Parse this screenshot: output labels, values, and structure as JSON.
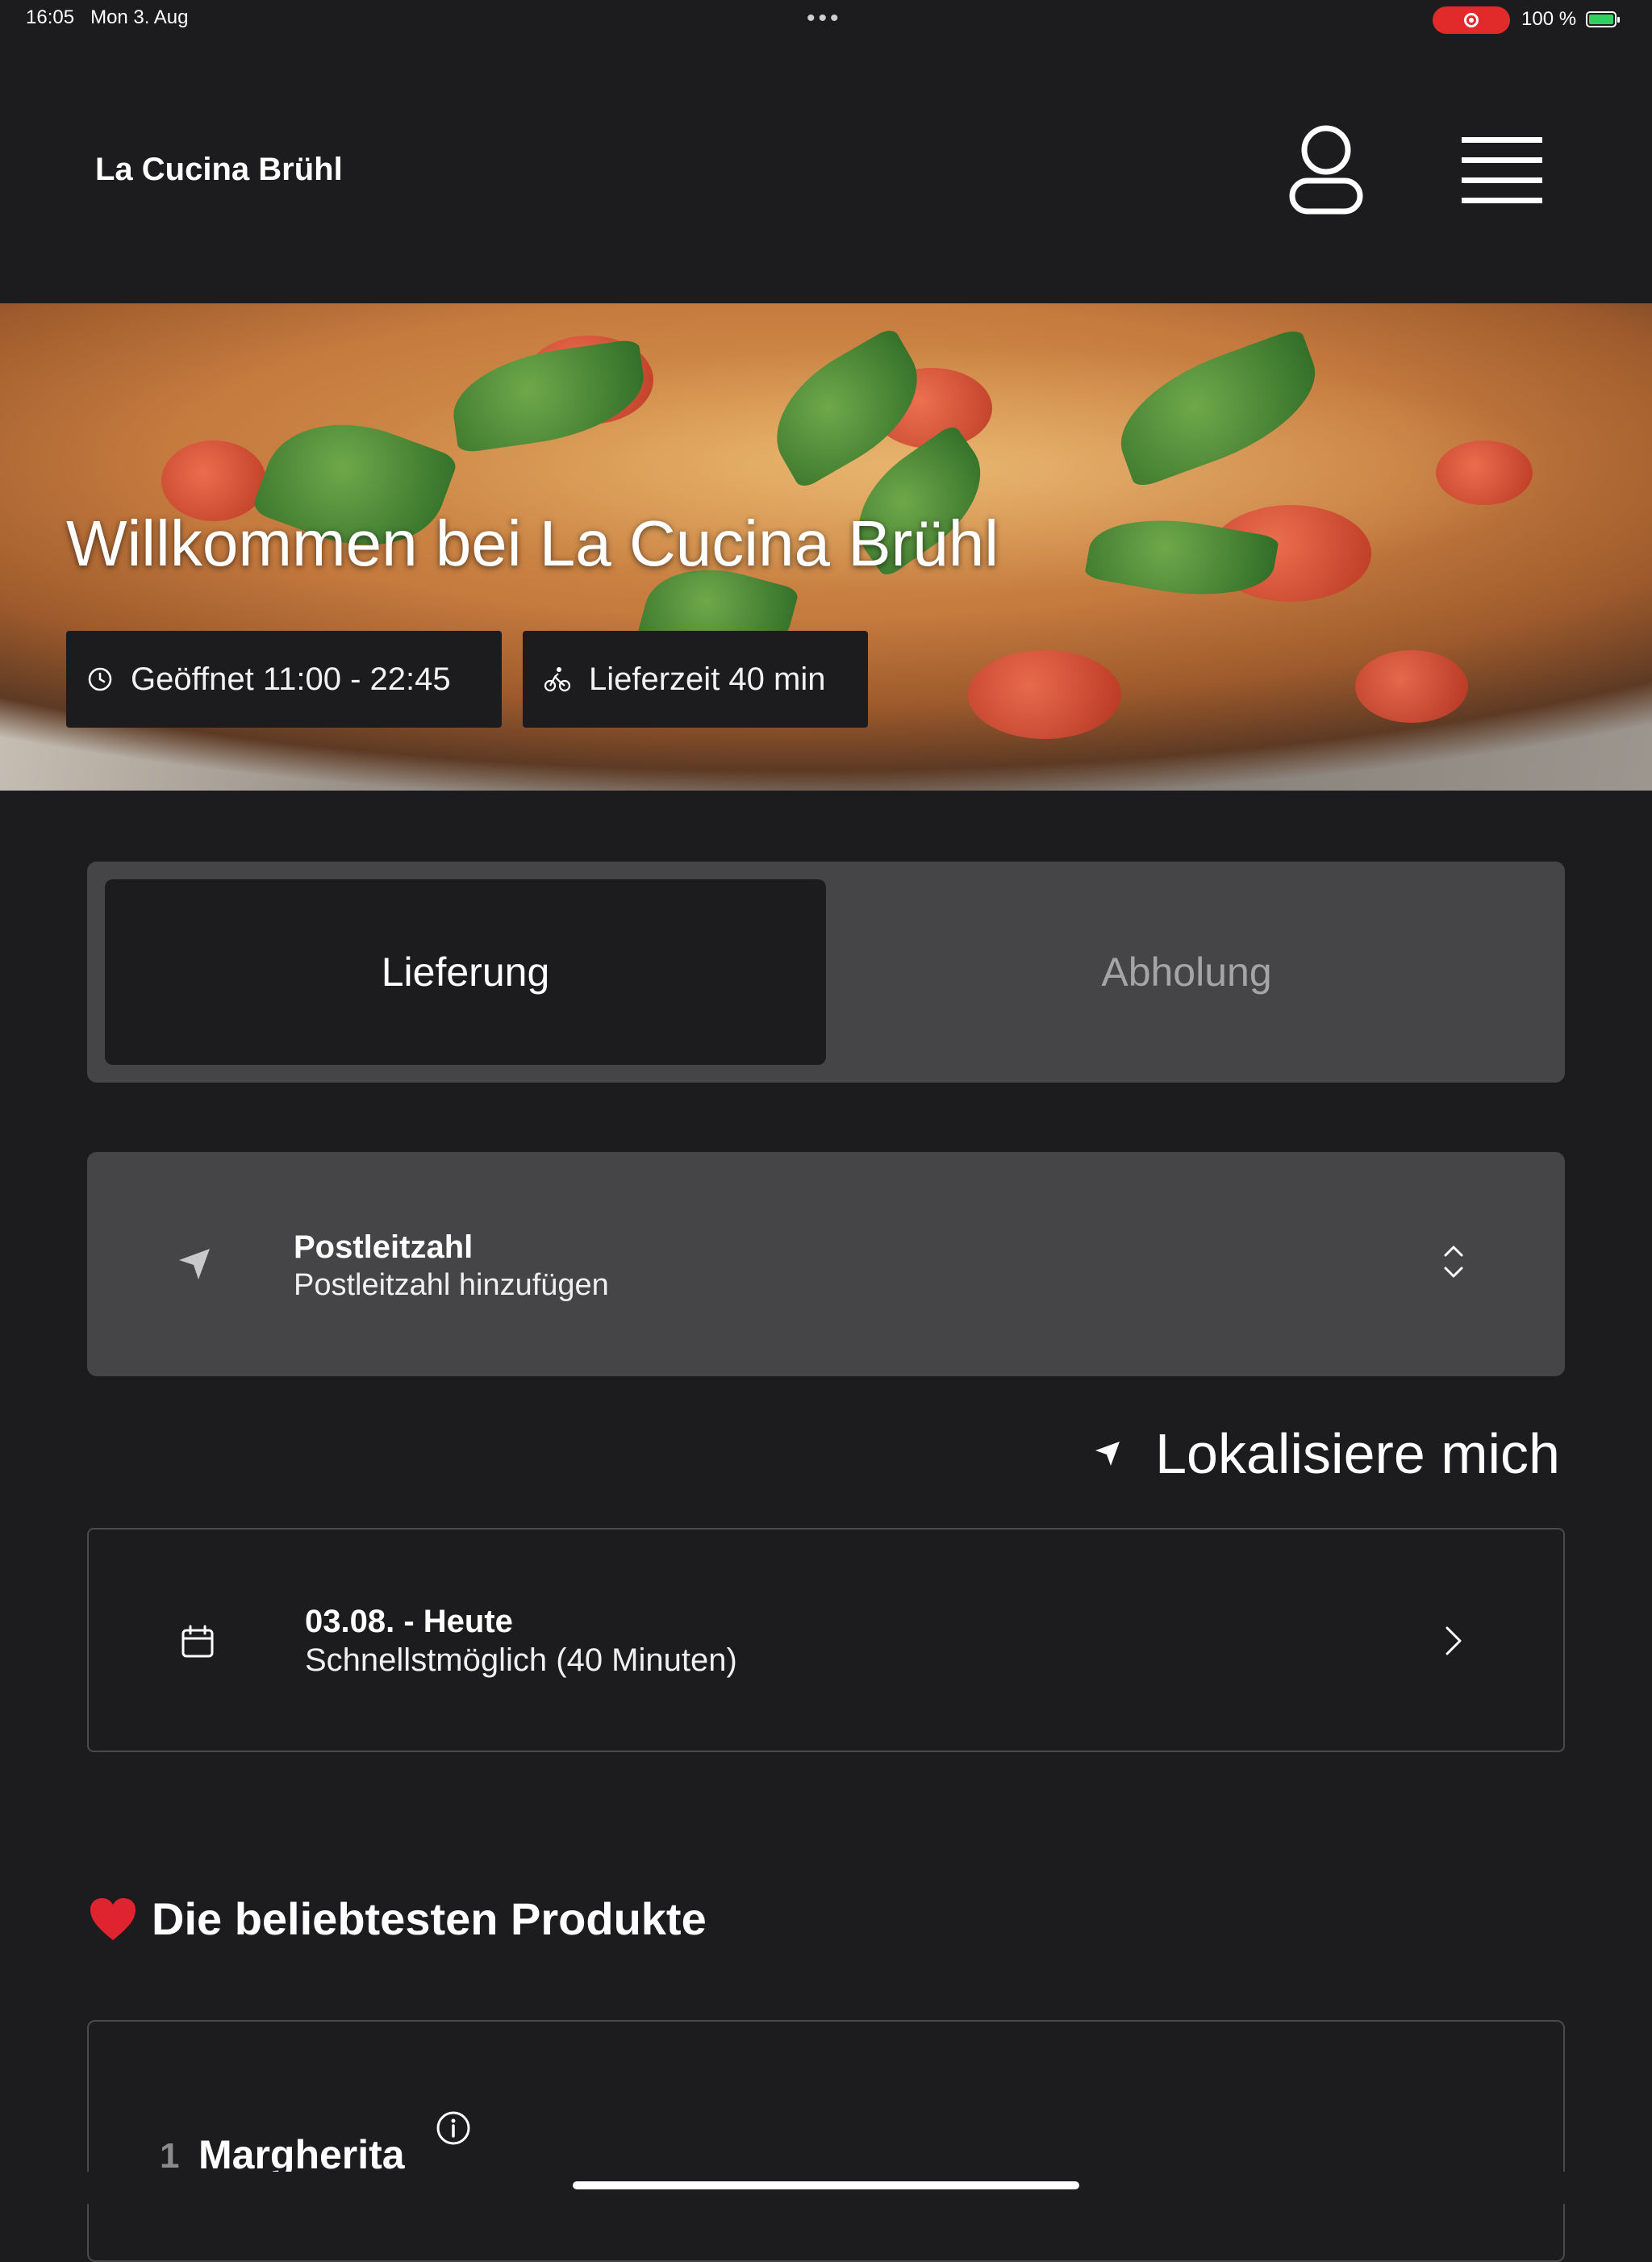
{
  "status_bar": {
    "time": "16:05",
    "date": "Mon 3. Aug",
    "dots": "•••",
    "battery_text": "100 %"
  },
  "header": {
    "brand": "La Cucina Brühl",
    "user_icon": "user-icon",
    "menu_icon": "hamburger-menu-icon"
  },
  "hero": {
    "title": "Willkommen bei La Cucina Brühl",
    "hours_label": "Geöffnet 11:00 - 22:45",
    "delivery_label": "Lieferzeit 40 min",
    "hours_icon": "clock-icon",
    "delivery_icon": "bike-icon"
  },
  "tabs": {
    "delivery": "Lieferung",
    "pickup": "Abholung",
    "active": "delivery"
  },
  "zip": {
    "label": "Postleitzahl",
    "placeholder": "Postleitzahl hinzufügen",
    "icon": "location-arrow-icon"
  },
  "locate": {
    "label": "Lokalisiere mich"
  },
  "schedule": {
    "label": "03.08. - Heute",
    "value": "Schnellstmöglich (40 Minuten)",
    "icon": "calendar-icon"
  },
  "popular": {
    "title": "Die beliebtesten Produkte",
    "icon": "heart-icon",
    "items": [
      {
        "number": "1",
        "name": "Margherita"
      }
    ]
  },
  "colors": {
    "background": "#1c1b1d",
    "card": "#454446",
    "record": "#e12b2b",
    "battery": "#30d158"
  }
}
